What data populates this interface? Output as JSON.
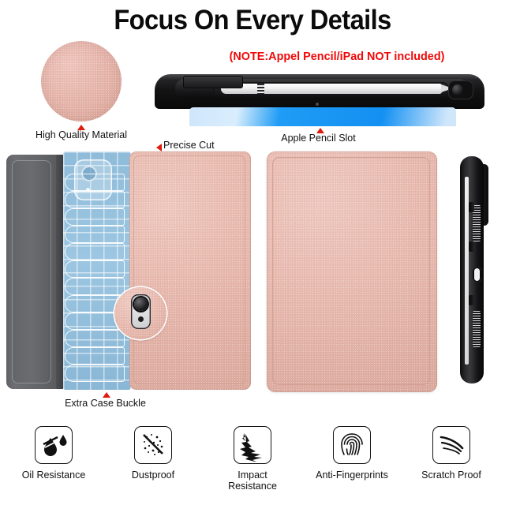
{
  "page": {
    "title": "Focus On Every Details",
    "note": "(NOTE:Appel Pencil/iPad NOT included)",
    "background_color": "#ffffff",
    "note_color": "#f00808",
    "marker_color": "#e01b0c"
  },
  "callouts": {
    "material": {
      "label": "High Quality Material",
      "swatch_color": "#e4b2a8",
      "marker": "triangle-up"
    },
    "pencil_slot": {
      "label": "Apple Pencil Slot",
      "marker": "triangle-up"
    },
    "precise_cut": {
      "label": "Precise Cut",
      "marker": "triangle-left"
    },
    "case_buckle": {
      "label": "Extra Case Buckle",
      "marker": "triangle-up"
    }
  },
  "product": {
    "case_color": "#e6b6ab",
    "flap_color": "#63656a",
    "buckle_color": "#9cc6e1",
    "frame_color": "#141415",
    "screen_color": "#1390f2"
  },
  "features": [
    {
      "label": "Oil Resistance",
      "icon": "oil-drop-icon"
    },
    {
      "label": "Dustproof",
      "icon": "dust-slash-icon"
    },
    {
      "label": "Impact\nResistance",
      "icon": "impact-burst-icon"
    },
    {
      "label": "Anti-Fingerprints",
      "icon": "fingerprint-icon"
    },
    {
      "label": "Scratch Proof",
      "icon": "scratch-arcs-icon"
    }
  ]
}
